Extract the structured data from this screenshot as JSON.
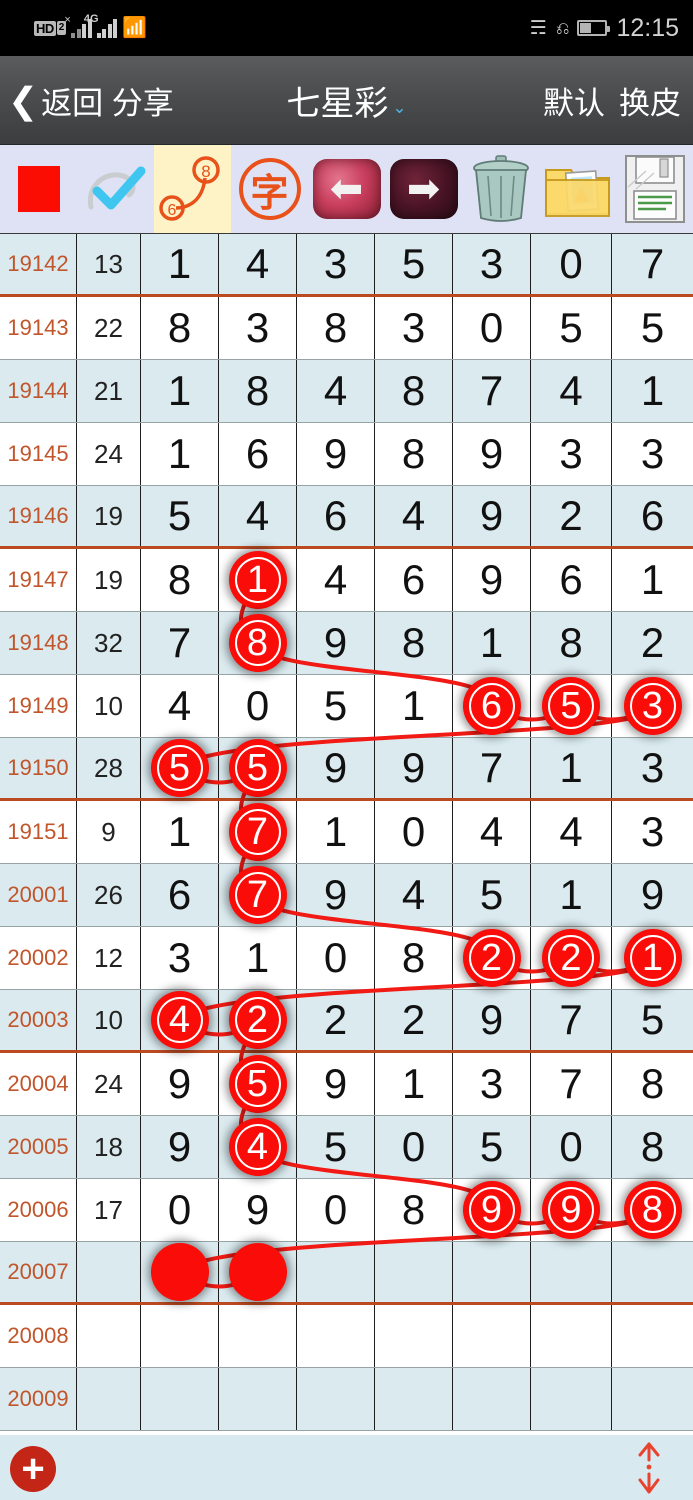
{
  "statusbar": {
    "hd_label": "HD",
    "sim_label": "2",
    "sim1_marker": "×",
    "sim2_marker": "4G",
    "wifi_icon": "wifi-icon",
    "bluetooth_icon": "bluetooth-icon",
    "vibrate_icon": "vibrate-icon",
    "battery_icon": "battery-icon",
    "time": "12:15"
  },
  "titlebar": {
    "back_label": "返回 分享",
    "back_chevron": "❮",
    "title": "七星彩",
    "caret": "⌄",
    "skin_default": "默认",
    "skin_change": "换皮"
  },
  "toolbar": {
    "items": [
      {
        "name": "stop-square-icon",
        "label": "红方块"
      },
      {
        "name": "check-pen-icon",
        "label": "勾选笔"
      },
      {
        "name": "connect-68-icon",
        "label": "6-8连线",
        "from": "6",
        "to": "8",
        "selected": true
      },
      {
        "name": "zi-character-icon",
        "label": "字",
        "glyph": "字"
      },
      {
        "name": "arrow-left-icon",
        "label": "上一页",
        "glyph": "⬅"
      },
      {
        "name": "arrow-right-icon",
        "label": "下一页",
        "glyph": "➡"
      },
      {
        "name": "trash-icon",
        "label": "删除"
      },
      {
        "name": "folder-photos-icon",
        "label": "图库"
      },
      {
        "name": "floppy-save-icon",
        "label": "保存"
      }
    ]
  },
  "table": {
    "col_count": 9,
    "rows": [
      {
        "issue": "19142",
        "sum": "13",
        "nums": [
          "1",
          "4",
          "3",
          "5",
          "3",
          "0",
          "7"
        ],
        "marks": [],
        "sep": true
      },
      {
        "issue": "19143",
        "sum": "22",
        "nums": [
          "8",
          "3",
          "8",
          "3",
          "0",
          "5",
          "5"
        ],
        "marks": [],
        "sep": false
      },
      {
        "issue": "19144",
        "sum": "21",
        "nums": [
          "1",
          "8",
          "4",
          "8",
          "7",
          "4",
          "1"
        ],
        "marks": [],
        "sep": false
      },
      {
        "issue": "19145",
        "sum": "24",
        "nums": [
          "1",
          "6",
          "9",
          "8",
          "9",
          "3",
          "3"
        ],
        "marks": [],
        "sep": false
      },
      {
        "issue": "19146",
        "sum": "19",
        "nums": [
          "5",
          "4",
          "6",
          "4",
          "9",
          "2",
          "6"
        ],
        "marks": [],
        "sep": true
      },
      {
        "issue": "19147",
        "sum": "19",
        "nums": [
          "8",
          "1",
          "4",
          "6",
          "9",
          "6",
          "1"
        ],
        "marks": [
          1
        ],
        "sep": false
      },
      {
        "issue": "19148",
        "sum": "32",
        "nums": [
          "7",
          "8",
          "9",
          "8",
          "1",
          "8",
          "2"
        ],
        "marks": [
          1
        ],
        "sep": false
      },
      {
        "issue": "19149",
        "sum": "10",
        "nums": [
          "4",
          "0",
          "5",
          "1",
          "6",
          "5",
          "3"
        ],
        "marks": [
          4,
          5,
          6
        ],
        "sep": false
      },
      {
        "issue": "19150",
        "sum": "28",
        "nums": [
          "5",
          "5",
          "9",
          "9",
          "7",
          "1",
          "3"
        ],
        "marks": [
          0,
          1
        ],
        "sep": true
      },
      {
        "issue": "19151",
        "sum": "9",
        "nums": [
          "1",
          "7",
          "1",
          "0",
          "4",
          "4",
          "3"
        ],
        "marks": [
          1
        ],
        "sep": false
      },
      {
        "issue": "20001",
        "sum": "26",
        "nums": [
          "6",
          "7",
          "9",
          "4",
          "5",
          "1",
          "9"
        ],
        "marks": [
          1
        ],
        "sep": false
      },
      {
        "issue": "20002",
        "sum": "12",
        "nums": [
          "3",
          "1",
          "0",
          "8",
          "2",
          "2",
          "1"
        ],
        "marks": [
          4,
          5,
          6
        ],
        "sep": false
      },
      {
        "issue": "20003",
        "sum": "10",
        "nums": [
          "4",
          "2",
          "2",
          "2",
          "9",
          "7",
          "5"
        ],
        "marks": [
          0,
          1
        ],
        "sep": true
      },
      {
        "issue": "20004",
        "sum": "24",
        "nums": [
          "9",
          "5",
          "9",
          "1",
          "3",
          "7",
          "8"
        ],
        "marks": [
          1
        ],
        "sep": false
      },
      {
        "issue": "20005",
        "sum": "18",
        "nums": [
          "9",
          "4",
          "5",
          "0",
          "5",
          "0",
          "8"
        ],
        "marks": [
          1
        ],
        "sep": false
      },
      {
        "issue": "20006",
        "sum": "17",
        "nums": [
          "0",
          "9",
          "0",
          "8",
          "9",
          "9",
          "8"
        ],
        "marks": [
          4,
          5,
          6
        ],
        "sep": false
      },
      {
        "issue": "20007",
        "sum": "",
        "nums": [
          "",
          "",
          "",
          "",
          "",
          "",
          ""
        ],
        "marks": [
          0,
          1
        ],
        "blank_marks": true,
        "sep": true
      },
      {
        "issue": "20008",
        "sum": "",
        "nums": [
          "",
          "",
          "",
          "",
          "",
          "",
          ""
        ],
        "marks": [],
        "sep": false
      },
      {
        "issue": "20009",
        "sum": "",
        "nums": [
          "",
          "",
          "",
          "",
          "",
          "",
          ""
        ],
        "marks": [],
        "sep": false
      }
    ]
  },
  "bottombar": {
    "add_label": "+",
    "scroll_icon": "scroll-up-down-icon"
  },
  "colors": {
    "accent_red": "#fa0c08",
    "issue_text": "#c1552c",
    "row_alt": "#daeaef",
    "separator": "#bc4a21",
    "toolbar_bg": "#dfe2f4",
    "titlebar_bg": "#4a4c4e",
    "bottombar_bg": "#d8eaf0"
  }
}
